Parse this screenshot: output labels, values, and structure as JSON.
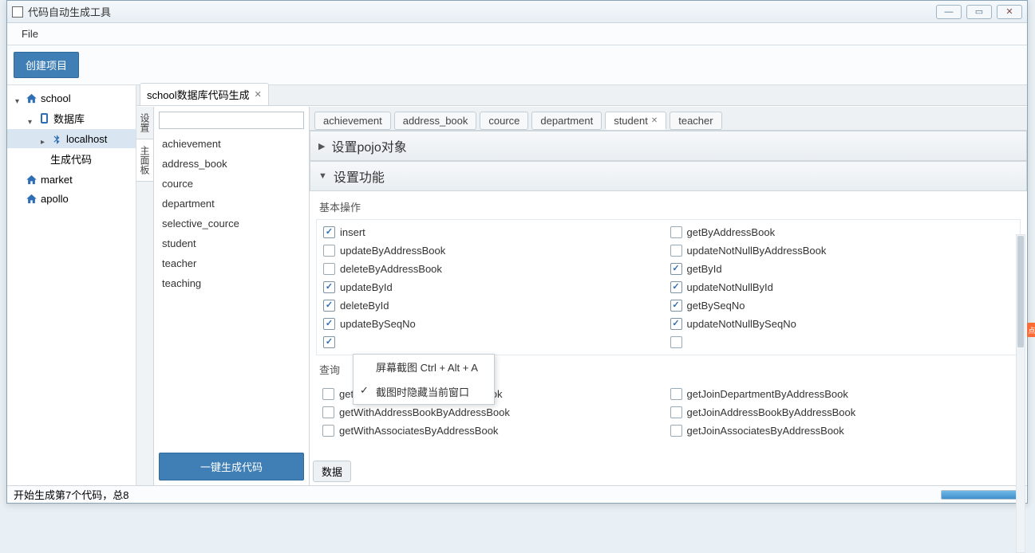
{
  "window": {
    "title": "代码自动生成工具"
  },
  "menubar": {
    "file": "File"
  },
  "toolbar": {
    "create_project": "创建项目"
  },
  "tree": {
    "school": "school",
    "database": "数据库",
    "localhost": "localhost",
    "gen_code": "生成代码",
    "market": "market",
    "apollo": "apollo"
  },
  "editor_tab": {
    "label": "school数据库代码生成"
  },
  "vert_tabs": {
    "settings": "设置",
    "main_panel": "主面板"
  },
  "tables": [
    "achievement",
    "address_book",
    "cource",
    "department",
    "selective_cource",
    "student",
    "teacher",
    "teaching"
  ],
  "generate_btn": "一键生成代码",
  "entity_tabs": [
    "achievement",
    "address_book",
    "cource",
    "department",
    "student",
    "teacher"
  ],
  "entity_active_index": 4,
  "accordion": {
    "pojo": "设置pojo对象",
    "func": "设置功能"
  },
  "sections": {
    "basic_ops": "基本操作",
    "query": "查询"
  },
  "ops_basic": [
    {
      "l": "insert",
      "lc": true,
      "r": "getByAddressBook",
      "rc": false
    },
    {
      "l": "updateByAddressBook",
      "lc": false,
      "r": "updateNotNullByAddressBook",
      "rc": false
    },
    {
      "l": "deleteByAddressBook",
      "lc": false,
      "r": "getById",
      "rc": true
    },
    {
      "l": "updateById",
      "lc": true,
      "r": "updateNotNullById",
      "rc": true
    },
    {
      "l": "deleteById",
      "lc": true,
      "r": "getBySeqNo",
      "rc": true
    },
    {
      "l": "updateBySeqNo",
      "lc": true,
      "r": "updateNotNullBySeqNo",
      "rc": true
    },
    {
      "l": "",
      "lc": true,
      "r": "",
      "rc": false
    }
  ],
  "ops_query": [
    {
      "l": "getWithDepartmentByAddressBook",
      "lc": false,
      "r": "getJoinDepartmentByAddressBook",
      "rc": false
    },
    {
      "l": "getWithAddressBookByAddressBook",
      "lc": false,
      "r": "getJoinAddressBookByAddressBook",
      "rc": false
    },
    {
      "l": "getWithAssociatesByAddressBook",
      "lc": false,
      "r": "getJoinAssociatesByAddressBook",
      "rc": false
    }
  ],
  "data_btn": "数据",
  "context_menu": {
    "item1": "屏幕截图 Ctrl + Alt + A",
    "item2": "截图时隐藏当前窗口"
  },
  "statusbar": {
    "text": "开始生成第7个代码，总8"
  },
  "edge_tag": "点"
}
